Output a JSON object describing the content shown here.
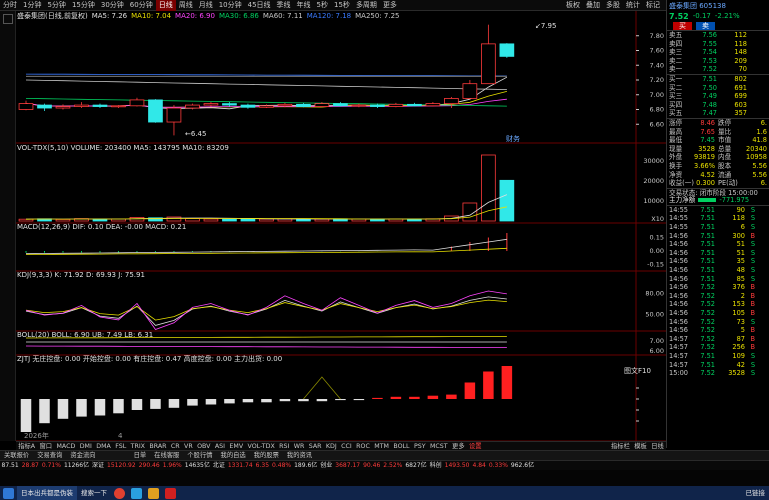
{
  "topbar": {
    "tabs": [
      "分时",
      "1分钟",
      "5分钟",
      "15分钟",
      "30分钟",
      "60分钟",
      "日线",
      "周线",
      "月线",
      "10分钟",
      "45日线",
      "季线",
      "年线",
      "5秒",
      "15秒",
      "多周期",
      "更多"
    ],
    "active_tab": "日线",
    "tools": [
      "板权",
      "叠加",
      "多股",
      "统计",
      "标记",
      "自画",
      "指标",
      "模板",
      "关闭"
    ],
    "right_label": "我的"
  },
  "main_legend": {
    "title": "盛泰集团(日线,前复权)",
    "items": [
      {
        "label": "MA5: 7.26",
        "color": "#e0e0e0"
      },
      {
        "label": "MA10: 7.04",
        "color": "#e8e000"
      },
      {
        "label": "MA20: 6.90",
        "color": "#ff44ff"
      },
      {
        "label": "MA30: 6.86",
        "color": "#00d060"
      },
      {
        "label": "MA60: 7.11",
        "color": "#c8c8c8"
      },
      {
        "label": "MA120: 7.18",
        "color": "#3a7aff"
      },
      {
        "label": "MA250: 7.25",
        "color": "#c8c8c8"
      }
    ],
    "high_marker": "7.95",
    "low_marker": "6.45",
    "price_axis": [
      "7.80",
      "7.60",
      "7.40",
      "7.20",
      "7.00",
      "6.80",
      "6.60"
    ],
    "flag": "财务"
  },
  "candles": [
    {
      "o": 6.8,
      "c": 6.88,
      "h": 6.92,
      "l": 6.79
    },
    {
      "o": 6.86,
      "c": 6.82,
      "h": 6.88,
      "l": 6.78
    },
    {
      "o": 6.82,
      "c": 6.84,
      "h": 6.87,
      "l": 6.8
    },
    {
      "o": 6.84,
      "c": 6.86,
      "h": 6.9,
      "l": 6.82
    },
    {
      "o": 6.86,
      "c": 6.84,
      "h": 6.88,
      "l": 6.82
    },
    {
      "o": 6.84,
      "c": 6.85,
      "h": 6.86,
      "l": 6.82
    },
    {
      "o": 6.85,
      "c": 6.93,
      "h": 6.96,
      "l": 6.84
    },
    {
      "o": 6.93,
      "c": 6.63,
      "h": 6.94,
      "l": 6.62
    },
    {
      "o": 6.63,
      "c": 6.82,
      "h": 6.86,
      "l": 6.45
    },
    {
      "o": 6.82,
      "c": 6.86,
      "h": 6.88,
      "l": 6.8
    },
    {
      "o": 6.86,
      "c": 6.88,
      "h": 6.9,
      "l": 6.84
    },
    {
      "o": 6.88,
      "c": 6.86,
      "h": 6.9,
      "l": 6.84
    },
    {
      "o": 6.86,
      "c": 6.83,
      "h": 6.88,
      "l": 6.81
    },
    {
      "o": 6.83,
      "c": 6.85,
      "h": 6.87,
      "l": 6.82
    },
    {
      "o": 6.85,
      "c": 6.87,
      "h": 6.89,
      "l": 6.83
    },
    {
      "o": 6.87,
      "c": 6.84,
      "h": 6.89,
      "l": 6.83
    },
    {
      "o": 6.84,
      "c": 6.88,
      "h": 6.9,
      "l": 6.83
    },
    {
      "o": 6.88,
      "c": 6.85,
      "h": 6.9,
      "l": 6.84
    },
    {
      "o": 6.85,
      "c": 6.86,
      "h": 6.88,
      "l": 6.83
    },
    {
      "o": 6.86,
      "c": 6.84,
      "h": 6.88,
      "l": 6.82
    },
    {
      "o": 6.84,
      "c": 6.87,
      "h": 6.89,
      "l": 6.83
    },
    {
      "o": 6.87,
      "c": 6.85,
      "h": 6.89,
      "l": 6.84
    },
    {
      "o": 6.85,
      "c": 6.88,
      "h": 6.9,
      "l": 6.84
    },
    {
      "o": 6.88,
      "c": 6.95,
      "h": 6.97,
      "l": 6.82
    },
    {
      "o": 6.95,
      "c": 7.15,
      "h": 7.2,
      "l": 6.94
    },
    {
      "o": 7.15,
      "c": 7.69,
      "h": 7.95,
      "l": 7.15
    },
    {
      "o": 7.69,
      "c": 7.52,
      "h": 7.7,
      "l": 7.5
    }
  ],
  "volume": {
    "legend": "VOL-TDX(5,10)  VOLUME: 203400  MA5: 143795  MA10: 83209",
    "axis": [
      "30000",
      "20000",
      "10000",
      "X10"
    ],
    "values": [
      900,
      1100,
      800,
      1200,
      950,
      1000,
      1800,
      1600,
      2000,
      1200,
      1000,
      900,
      1100,
      950,
      1050,
      1000,
      900,
      1100,
      1000,
      950,
      1000,
      900,
      1100,
      2500,
      9000,
      33000,
      20340
    ]
  },
  "macd": {
    "legend": "MACD(12,26,9)  DIF: 0.10  DEA: -0.00  MACD: 0.21",
    "axis": [
      "0.15",
      "0.00",
      "-0.15"
    ]
  },
  "kdj": {
    "legend": "KDJ(9,3,3)  K: 71.92  D: 69.93  J: 75.91",
    "axis": [
      "80.00",
      "50.00"
    ]
  },
  "boll": {
    "legend": "BOLL(20)  BOLL: 6.90  UB: 7.49  LB: 6.31",
    "axis": [
      "7.00",
      "6.00"
    ]
  },
  "zjtj": {
    "legend": "ZJTJ  无庄控盘: 0.00  开始控盘: 0.00  有庄控盘: 0.47  高度控盘: 0.00  主力出货: 0.00",
    "bars": [
      -30,
      -22,
      -18,
      -16,
      -15,
      -13,
      -10,
      -9,
      -8,
      -6,
      -5,
      -4,
      -3,
      -3,
      -2,
      -2,
      -2,
      -1,
      -1,
      1,
      2,
      2,
      3,
      4,
      15,
      25,
      30
    ],
    "date_left": "2026年",
    "date_mid": "4",
    "axis_label": "图文F10"
  },
  "bottom_tabs": {
    "items": [
      "指标A",
      "窗口",
      "MACD",
      "DMI",
      "DMA",
      "FSL",
      "TRIX",
      "BRAR",
      "CR",
      "VR",
      "OBV",
      "ASI",
      "EMV",
      "VOL-TDX",
      "RSI",
      "WR",
      "SAR",
      "KDJ",
      "CCI",
      "ROC",
      "MTM",
      "BOLL",
      "PSY",
      "MCST",
      "更多",
      "设置"
    ],
    "right_items": [
      "指标栏",
      "模板",
      "日线"
    ]
  },
  "right_panel": {
    "code": "盛泰集团 605138",
    "price": "7.52",
    "change": "-0.17",
    "pct": "-2.21%",
    "buy_btn": "买",
    "sell_btn": "卖",
    "sell_levels": [
      {
        "label": "卖五",
        "price": "7.56",
        "vol": "112"
      },
      {
        "label": "卖四",
        "price": "7.55",
        "vol": "118"
      },
      {
        "label": "卖三",
        "price": "7.54",
        "vol": "148"
      },
      {
        "label": "卖二",
        "price": "7.53",
        "vol": "209"
      },
      {
        "label": "卖一",
        "price": "7.52",
        "vol": "70"
      }
    ],
    "buy_levels": [
      {
        "label": "买一",
        "price": "7.51",
        "vol": "802"
      },
      {
        "label": "买二",
        "price": "7.50",
        "vol": "691"
      },
      {
        "label": "买三",
        "price": "7.49",
        "vol": "699"
      },
      {
        "label": "买四",
        "price": "7.48",
        "vol": "603"
      },
      {
        "label": "买五",
        "price": "7.47",
        "vol": "357"
      }
    ],
    "stats": [
      {
        "a": "涨停",
        "b": "8.46",
        "c": "跌停",
        "d": "6."
      },
      {
        "a": "最高",
        "b": "7.65",
        "c": "量比",
        "d": "1.6"
      },
      {
        "a": "最低",
        "b": "7.45",
        "c": "市值",
        "d": "41.8"
      },
      {
        "a": "现量",
        "b": "3528",
        "c": "总量",
        "d": "20340"
      },
      {
        "a": "外盘",
        "b": "93819",
        "c": "内盘",
        "d": "10958"
      },
      {
        "a": "换手",
        "b": "3.66%",
        "c": "股本",
        "d": "5.56"
      },
      {
        "a": "净资",
        "b": "4.52",
        "c": "流通",
        "d": "5.56"
      },
      {
        "a": "收益(一)",
        "b": "0.300",
        "c": "PE(动)",
        "d": "6."
      }
    ],
    "status_line": "交易状态: 闭市阶段 15:00:00",
    "flow_label": "主力净额",
    "flow_value": "-771.975",
    "ticks": [
      {
        "t": "14:55",
        "p": "7.51",
        "v": "90",
        "s": "S"
      },
      {
        "t": "14:55",
        "p": "7.51",
        "v": "118",
        "s": "S"
      },
      {
        "t": "14:55",
        "p": "7.51",
        "v": "6",
        "s": "S"
      },
      {
        "t": "14:56",
        "p": "7.51",
        "v": "300",
        "s": "B"
      },
      {
        "t": "14:56",
        "p": "7.51",
        "v": "51",
        "s": "S"
      },
      {
        "t": "14:56",
        "p": "7.51",
        "v": "51",
        "s": "S"
      },
      {
        "t": "14:56",
        "p": "7.51",
        "v": "35",
        "s": "S"
      },
      {
        "t": "14:56",
        "p": "7.51",
        "v": "48",
        "s": "S"
      },
      {
        "t": "14:56",
        "p": "7.51",
        "v": "85",
        "s": "S"
      },
      {
        "t": "14:56",
        "p": "7.52",
        "v": "376",
        "s": "B"
      },
      {
        "t": "14:56",
        "p": "7.52",
        "v": "2",
        "s": "B"
      },
      {
        "t": "14:56",
        "p": "7.52",
        "v": "153",
        "s": "B"
      },
      {
        "t": "14:56",
        "p": "7.52",
        "v": "105",
        "s": "B"
      },
      {
        "t": "14:56",
        "p": "7.52",
        "v": "73",
        "s": "S"
      },
      {
        "t": "14:56",
        "p": "7.52",
        "v": "5",
        "s": "B"
      },
      {
        "t": "14:57",
        "p": "7.52",
        "v": "87",
        "s": "B"
      },
      {
        "t": "14:57",
        "p": "7.52",
        "v": "256",
        "s": "B"
      },
      {
        "t": "14:57",
        "p": "7.51",
        "v": "109",
        "s": "S"
      },
      {
        "t": "14:57",
        "p": "7.51",
        "v": "42",
        "s": "S"
      },
      {
        "t": "15:00",
        "p": "7.52",
        "v": "3528",
        "s": "S"
      }
    ]
  },
  "status_tabs": [
    "关联报价",
    "交易查询",
    "资金流向"
  ],
  "status_bar": [
    "日单",
    "在线客服",
    "个股行情",
    "我的自选",
    "我的股票",
    "我的资讯"
  ],
  "market_bar": [
    {
      "t": "87.51",
      "c": "#e0e0e0"
    },
    {
      "t": "28.87",
      "c": "#ff3b3b"
    },
    {
      "t": "0.71%",
      "c": "#ff3b3b"
    },
    {
      "t": "11266亿",
      "c": "#e0e0e0"
    },
    {
      "t": "深证",
      "c": "#e0e0e0"
    },
    {
      "t": "15120.92",
      "c": "#ff3b3b"
    },
    {
      "t": "290.46",
      "c": "#ff3b3b"
    },
    {
      "t": "1.96%",
      "c": "#ff3b3b"
    },
    {
      "t": "14635亿",
      "c": "#e0e0e0"
    },
    {
      "t": "北证",
      "c": "#e0e0e0"
    },
    {
      "t": "1331.74",
      "c": "#ff3b3b"
    },
    {
      "t": "6.35",
      "c": "#ff3b3b"
    },
    {
      "t": "0.48%",
      "c": "#ff3b3b"
    },
    {
      "t": "189.6亿",
      "c": "#e0e0e0"
    },
    {
      "t": "创业",
      "c": "#e0e0e0"
    },
    {
      "t": "3687.17",
      "c": "#ff3b3b"
    },
    {
      "t": "90.46",
      "c": "#ff3b3b"
    },
    {
      "t": "2.52%",
      "c": "#ff3b3b"
    },
    {
      "t": "6827亿",
      "c": "#e0e0e0"
    },
    {
      "t": "科创",
      "c": "#e0e0e0"
    },
    {
      "t": "1493.50",
      "c": "#ff3b3b"
    },
    {
      "t": "4.84",
      "c": "#ff3b3b"
    },
    {
      "t": "0.33%",
      "c": "#ff3b3b"
    },
    {
      "t": "962.6亿",
      "c": "#e0e0e0"
    }
  ],
  "taskbar": {
    "window_title": "日本出兵都是伪装",
    "search_label": "搜索一下",
    "right_label": "已链接"
  }
}
